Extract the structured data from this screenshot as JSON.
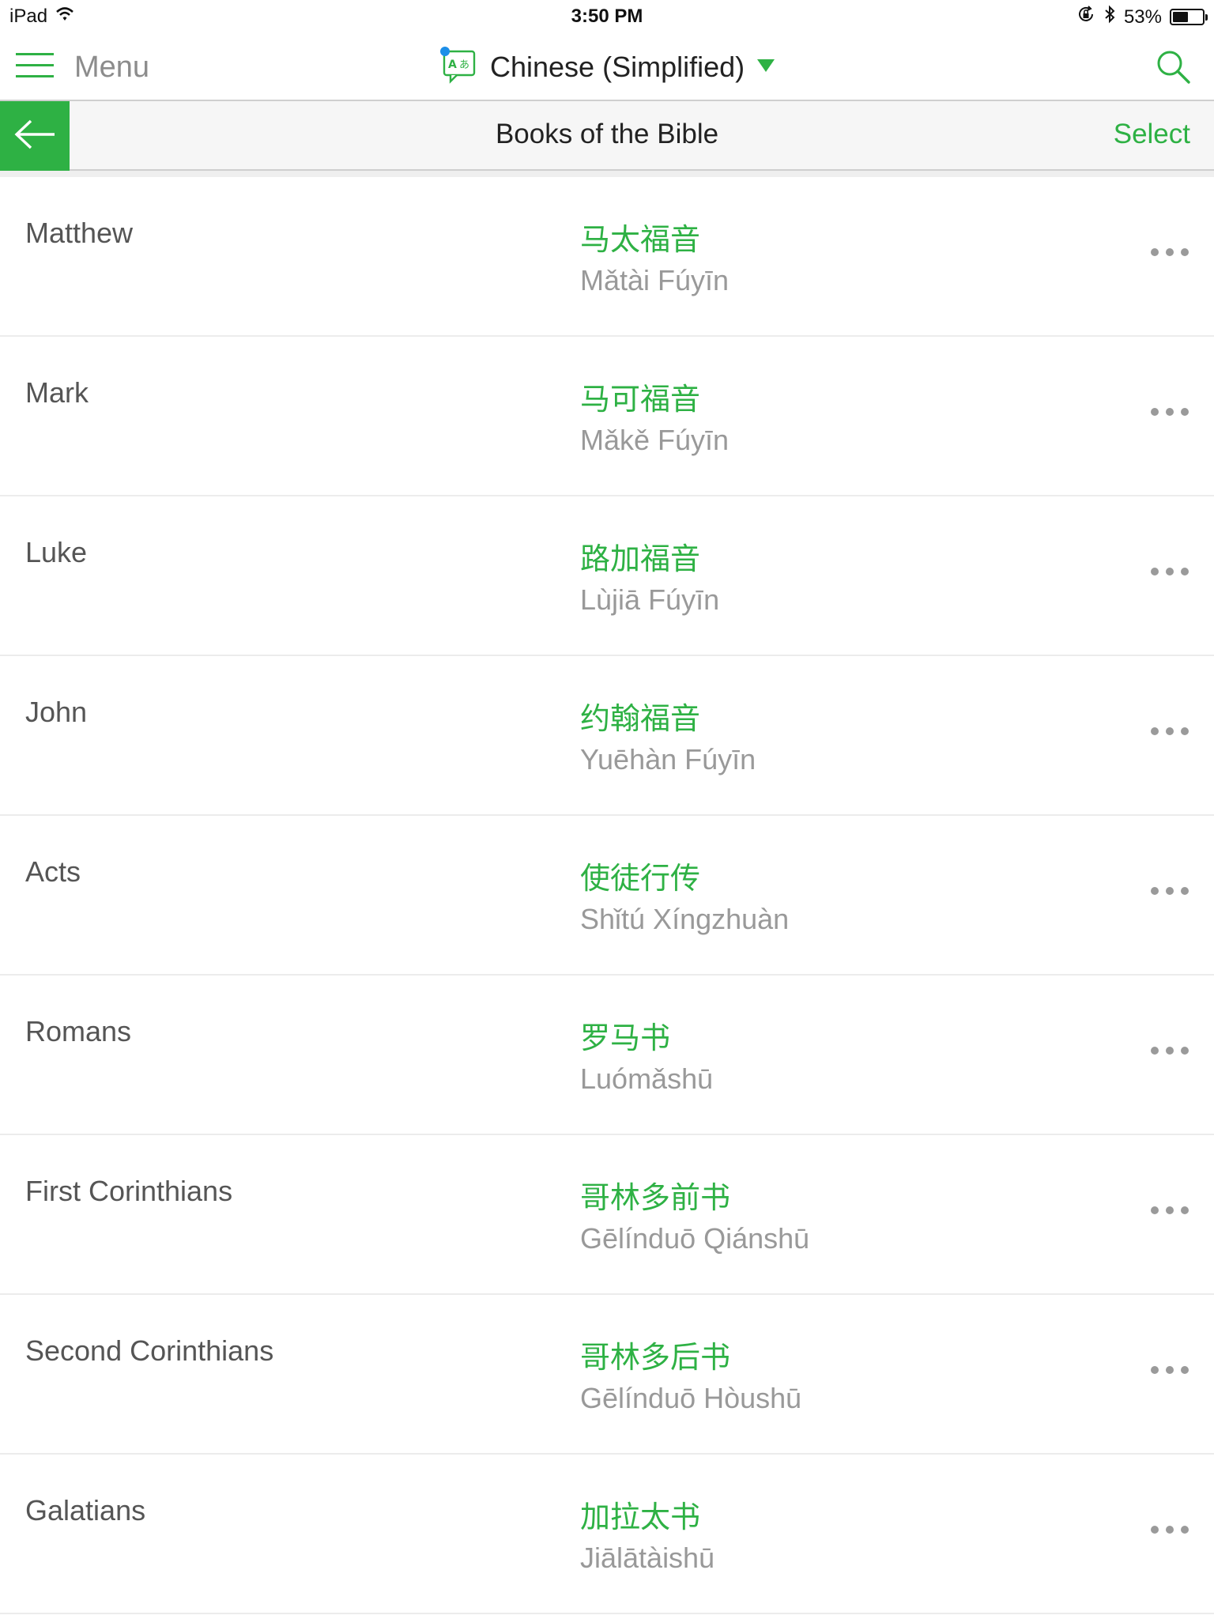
{
  "status_bar": {
    "device": "iPad",
    "time": "3:50 PM",
    "battery_text": "53%",
    "battery_level": 0.53
  },
  "app_bar": {
    "menu_label": "Menu",
    "language": "Chinese (Simplified)",
    "accent_color": "#2eb144"
  },
  "sub_header": {
    "title": "Books of the Bible",
    "select_label": "Select"
  },
  "books": [
    {
      "english": "Matthew",
      "chinese": "马太福音",
      "pinyin": "Mǎtài Fúyīn"
    },
    {
      "english": "Mark",
      "chinese": "马可福音",
      "pinyin": "Mǎkě Fúyīn"
    },
    {
      "english": "Luke",
      "chinese": "路加福音",
      "pinyin": "Lùjiā Fúyīn"
    },
    {
      "english": "John",
      "chinese": "约翰福音",
      "pinyin": "Yuēhàn Fúyīn"
    },
    {
      "english": "Acts",
      "chinese": "使徒行传",
      "pinyin": "Shǐtú Xíngzhuàn"
    },
    {
      "english": "Romans",
      "chinese": "罗马书",
      "pinyin": "Luómǎshū"
    },
    {
      "english": "First Corinthians",
      "chinese": "哥林多前书",
      "pinyin": "Gēlínduō Qiánshū"
    },
    {
      "english": "Second Corinthians",
      "chinese": "哥林多后书",
      "pinyin": "Gēlínduō Hòushū"
    },
    {
      "english": "Galatians",
      "chinese": "加拉太书",
      "pinyin": "Jiālātàishū"
    }
  ]
}
